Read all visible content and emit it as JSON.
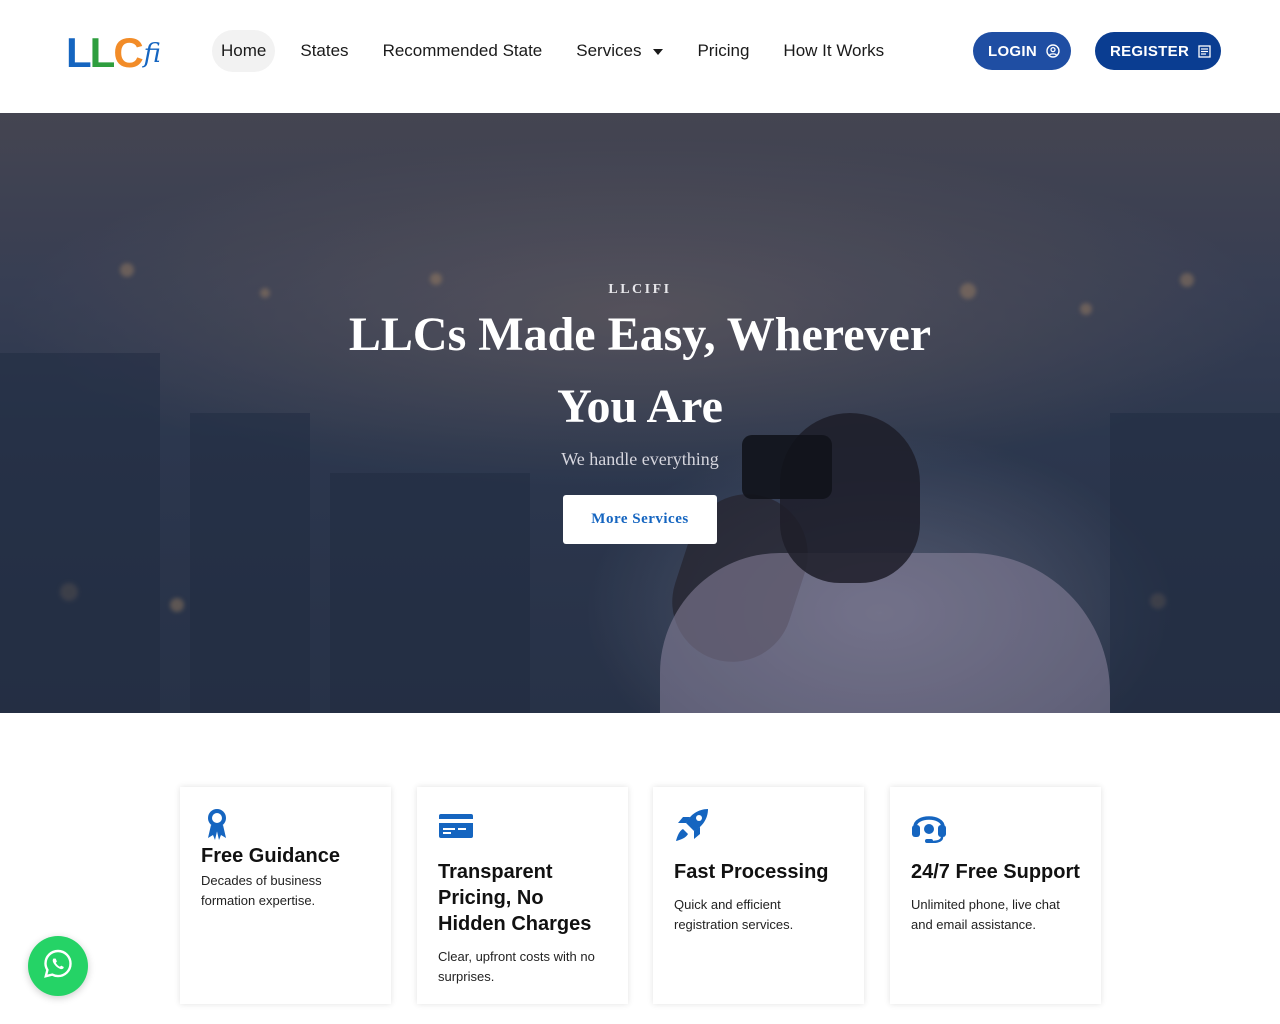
{
  "brand": {
    "logo_parts": [
      "L",
      "L",
      "C",
      "fi"
    ],
    "colors": {
      "blue": "#1565c0",
      "green": "#2e9e3e",
      "orange": "#f28c28"
    }
  },
  "nav": {
    "items": [
      {
        "label": "Home",
        "active": true
      },
      {
        "label": "States"
      },
      {
        "label": "Recommended State"
      },
      {
        "label": "Services",
        "has_dropdown": true
      },
      {
        "label": "Pricing"
      },
      {
        "label": "How It Works"
      }
    ]
  },
  "auth": {
    "login_label": "LOGIN",
    "login_icon": "user-circle-icon",
    "register_label": "REGISTER",
    "register_icon": "form-icon"
  },
  "hero": {
    "kicker": "LLCIFI",
    "title": "LLCs Made Easy, Wherever You Are",
    "subtitle": "We handle everything",
    "cta_label": "More Services"
  },
  "features": [
    {
      "icon": "award-ribbon-icon",
      "title": "Free Guidance",
      "text": "Decades of business formation expertise."
    },
    {
      "icon": "credit-card-icon",
      "title": "Transparent Pricing, No Hidden Charges",
      "text": "Clear, upfront costs with no surprises."
    },
    {
      "icon": "rocket-icon",
      "title": "Fast Processing",
      "text": "Quick and efficient registration services."
    },
    {
      "icon": "headset-icon",
      "title": "24/7 Free Support",
      "text": "Unlimited phone, live chat and email assistance."
    }
  ],
  "theme": {
    "accent": "#1565c0",
    "login_bg": "#1f4ea3",
    "register_bg": "#0a3d91",
    "whatsapp": "#25d366"
  },
  "chat_widget": {
    "icon": "whatsapp-icon"
  }
}
